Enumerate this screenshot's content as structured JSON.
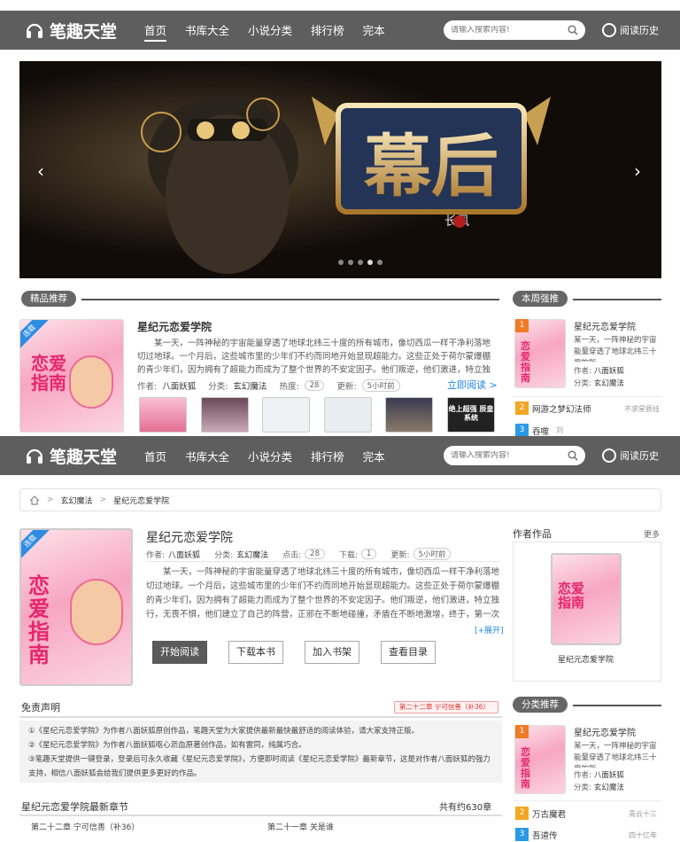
{
  "header": {
    "site_name": "笔趣天堂",
    "nav": [
      "首页",
      "书库大全",
      "小说分类",
      "排行榜",
      "完本"
    ],
    "search_placeholder": "请输入搜索内容!",
    "history_label": "阅读历史"
  },
  "banner": {
    "title_art": "幕后",
    "author_art": "长风",
    "prev": "‹",
    "next": "›"
  },
  "featured": {
    "section_label": "精品推荐",
    "book_title": "星纪元恋爱学院",
    "cover_badge": "连载",
    "cover_art": "恋爱指南",
    "desc": "某一天，一阵神秘的宇宙能量穿透了地球北纬三十度的所有城市，像切西瓜一样干净利落地切过地球。一个月后，这些城市里的少年们不约而同地开始显现超能力。这些正处于荷尔蒙爆棚的青少年们，因为拥有了超能力而成为了整个世界的不安定因子。他们叛逆，他们激进，特立独行，无畏不惧，他们建立了自己的阵营，正邪在不断地碰撞，矛盾在",
    "author_label": "作者:",
    "author": "八面妖狐",
    "category_label": "分类:",
    "category": "玄幻魔法",
    "popularity_label": "热度:",
    "popularity": "28",
    "update_label": "更新:",
    "update": "5小时前",
    "read_link": "立即阅读 >",
    "last_thumb_text": "绝上超强 辰皇系统"
  },
  "weekly": {
    "section_label": "本周强推",
    "top_title": "星纪元恋爱学院",
    "top_desc": "某一天，一阵神秘的宇宙能量穿透了地球北纬三十度的所",
    "top_author_label": "作者:",
    "top_author": "八面妖狐",
    "top_category_label": "分类:",
    "top_category": "玄幻魔法",
    "items": [
      {
        "rank": "1",
        "title": ""
      },
      {
        "rank": "2",
        "title": "网游之梦幻法师",
        "extra": "不求星辰挂"
      },
      {
        "rank": "3",
        "title": "吞噬",
        "extra": "刘"
      }
    ]
  },
  "detail": {
    "breadcrumb": [
      "玄幻魔法",
      "星纪元恋爱学院"
    ],
    "title": "星纪元恋爱学院",
    "author_label": "作者:",
    "author": "八面妖狐",
    "category_label": "分类:",
    "category": "玄幻魔法",
    "clicks_label": "点击:",
    "clicks": "28",
    "downloads_label": "下载:",
    "downloads": "1",
    "update_label": "更新:",
    "update": "5小时前",
    "desc": "某一天，一阵神秘的宇宙能量穿透了地球北纬三十度的所有城市，像切西瓜一样干净利落地切过地球。一个月后，这些城市里的少年们不约而同地开始显现超能力。这些正处于荷尔蒙爆棚的青少年们，因为拥有了超能力而成为了整个世界的不安定因子。他们叛逆，他们激进，特立独行，无畏不惧，他们建立了自己的阵营，正邪在不断地碰撞，矛盾在不断地激增，终于，第一次世界异能大战发",
    "expand": "[+展开]",
    "buttons": [
      "开始阅读",
      "下载本书",
      "加入书架",
      "查看目录"
    ]
  },
  "disclaimer": {
    "title": "免责声明",
    "latest_tag": "第二十二章 宁可信善（补36）",
    "lines": [
      "①《星纪元恋爱学院》为作者八面妖狐原创作品，笔趣天堂为大家提供最新最快最舒适的阅读体验，请大家支持正版。",
      "②《星纪元恋爱学院》为作者八面妖狐呕心沥血原著创作品，如有雷同，纯属巧合。",
      "③笔趣天堂提供一键登录，登录后可永久收藏《星纪元恋爱学院》，方便即时阅读《星纪元恋爱学院》最新章节，这是对作者八面妖狐的强力支持，相信八面妖狐会给我们提供更多更好的作品。"
    ]
  },
  "chapters": {
    "title": "星纪元恋爱学院最新章节",
    "count": "共有约630章",
    "items": [
      "第二十二章 宁可信善（补36）",
      "第二十一章 关是谁"
    ]
  },
  "author_works": {
    "title": "作者作品",
    "more": "更多",
    "book": "星纪元恋爱学院"
  },
  "category_rec": {
    "section_label": "分类推荐",
    "top_title": "星纪元恋爱学院",
    "top_desc": "某一天，一阵神秘的宇宙能量穿透了地球北纬三十度的所",
    "top_author_label": "作者:",
    "top_author": "八面妖狐",
    "top_category_label": "分类:",
    "top_category": "玄幻魔法",
    "items": [
      {
        "rank": "2",
        "title": "万古魔君",
        "extra": "青云十三"
      },
      {
        "rank": "3",
        "title": "吾道传",
        "extra": "四十亿年"
      }
    ]
  },
  "colors": {
    "header": "#5e5e5e",
    "accent": "#ff6a00",
    "link": "#1e88e5",
    "rank1": "#f07b24",
    "rank2": "#f5a623",
    "rank3": "#2a9ae8"
  }
}
